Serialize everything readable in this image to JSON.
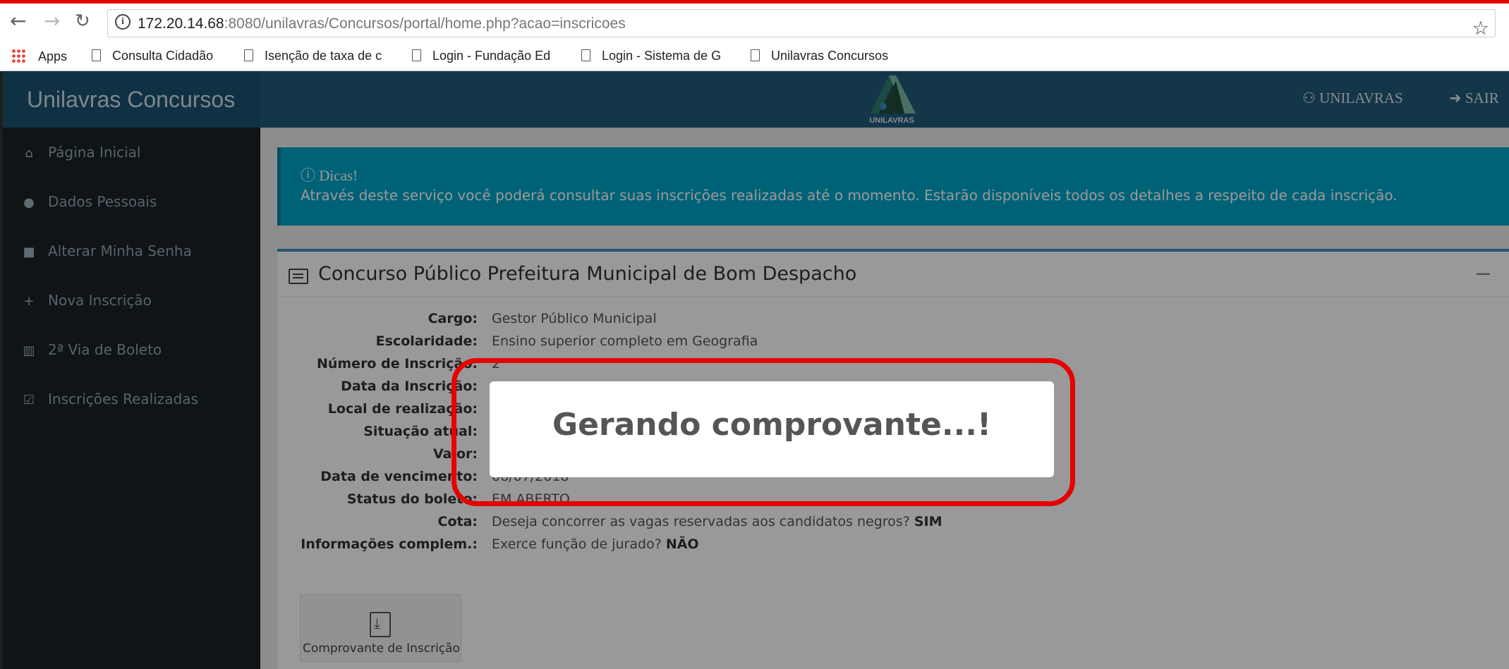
{
  "browser": {
    "back_icon": "arrow-left-icon",
    "forward_icon": "arrow-right-icon",
    "reload_icon": "reload-icon",
    "url_host": "172.20.14.68",
    "url_rest": ":8080/unilavras/Concursos/portal/home.php?acao=inscricoes",
    "bookmarks": [
      "Apps",
      "Consulta Cidadão",
      "Isenção de taxa de c",
      "Login - Fundação Ed",
      "Login - Sistema de G",
      "Unilavras Concursos"
    ]
  },
  "app": {
    "brand": "Unilavras Concursos",
    "logo_text": "UNILAVRAS",
    "user_label": "UNILAVRAS",
    "logout_label": "SAIR",
    "menu": [
      {
        "label": "Página Inicial",
        "icon": "home-icon"
      },
      {
        "label": "Dados Pessoais",
        "icon": "user-icon"
      },
      {
        "label": "Alterar Minha Senha",
        "icon": "lock-icon"
      },
      {
        "label": "Nova Inscrição",
        "icon": "plus-icon"
      },
      {
        "label": "2ª Via de Boleto",
        "icon": "barcode-icon"
      },
      {
        "label": "Inscrições Realizadas",
        "icon": "check-square-icon"
      }
    ]
  },
  "callout": {
    "title": "Dicas!",
    "body": "Através deste serviço você poderá consultar suas inscrições realizadas até o momento. Estarão disponíveis todos os detalhes a respeito de cada inscrição."
  },
  "box": {
    "title": "Concurso Público Prefeitura Municipal de Bom Despacho",
    "collapse": "−",
    "rows": [
      {
        "label": "Cargo:",
        "value": "Gestor Público Municipal"
      },
      {
        "label": "Escolaridade:",
        "value": "Ensino superior completo em Geografia"
      },
      {
        "label": "Número de Inscrição:",
        "value": "2"
      },
      {
        "label": "Data da Inscrição:",
        "value": ""
      },
      {
        "label": "Local de realização:",
        "value": ""
      },
      {
        "label": "Situação atual:",
        "value": ""
      },
      {
        "label": "Valor:",
        "value": ""
      },
      {
        "label": "Data de vencimento:",
        "value": "06/07/2018"
      },
      {
        "label": "Status do boleto:",
        "value": "EM ABERTO"
      }
    ],
    "cota_label": "Cota:",
    "cota_text": "Deseja concorrer as vagas reservadas aos candidatos negros? ",
    "cota_answer": "SIM",
    "info_label": "Informações complem.:",
    "info_text": "Exerce função de jurado? ",
    "info_answer": "NÃO",
    "pdf_button": "Comprovante de Inscrição"
  },
  "modal": {
    "message": "Gerando comprovante...!"
  },
  "colors": {
    "annotation": "#e60000",
    "brand": "#1b5271",
    "topbar": "#225a7a",
    "callout": "#00a3c6"
  }
}
